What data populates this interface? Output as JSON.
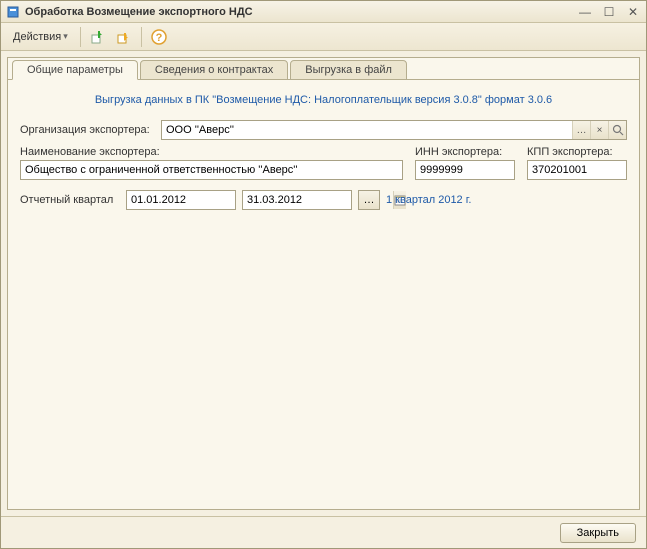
{
  "window": {
    "title": "Обработка  Возмещение экспортного НДС"
  },
  "toolbar": {
    "actions_label": "Действия"
  },
  "tabs": {
    "general": "Общие параметры",
    "contracts": "Сведения о контрактах",
    "export": "Выгрузка в файл"
  },
  "headline": "Выгрузка данных в ПК \"Возмещение НДС: Налогоплательщик версия 3.0.8\" формат 3.0.6",
  "labels": {
    "org": "Организация экспортера:",
    "name": "Наименование экспортера:",
    "inn": "ИНН экспортера:",
    "kpp": "КПП экспортера:",
    "quarter": "Отчетный квартал"
  },
  "fields": {
    "org": "ООО ''Аверс''",
    "name": "Общество с ограниченной ответственностью ''Аверс''",
    "inn": "9999999",
    "kpp": "370201001",
    "date_from": "01.01.2012",
    "date_to": "31.03.2012"
  },
  "quarter_text": "1 квартал 2012 г.",
  "footer": {
    "close": "Закрыть"
  }
}
